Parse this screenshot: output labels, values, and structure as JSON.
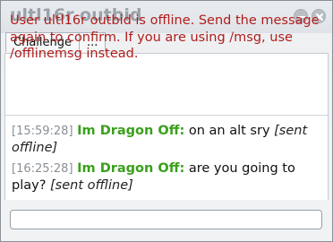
{
  "window": {
    "title": "ultl16r outbid",
    "minimize_icon": "minimize-icon",
    "close_icon": "close-icon"
  },
  "tabs": [
    {
      "label": "Challenge"
    },
    {
      "label": "..."
    }
  ],
  "notice": "User ultl16r outbid is offline. Send the message again to confirm. If you are using /msg, use /offlinemsg instead.",
  "messages": [
    {
      "timestamp": "[15:59:28]",
      "user": "Im Dragon Off:",
      "text": "on an alt sry",
      "status": "[sent offline]"
    },
    {
      "timestamp": "[16:25:28]",
      "user": "Im Dragon Off:",
      "text": "are you going to play?",
      "status": "[sent offline]"
    }
  ],
  "input": {
    "value": "",
    "placeholder": ""
  },
  "colors": {
    "notice": "#b11c1c",
    "username": "#3aa01c",
    "timestamp": "#8a8f95"
  }
}
